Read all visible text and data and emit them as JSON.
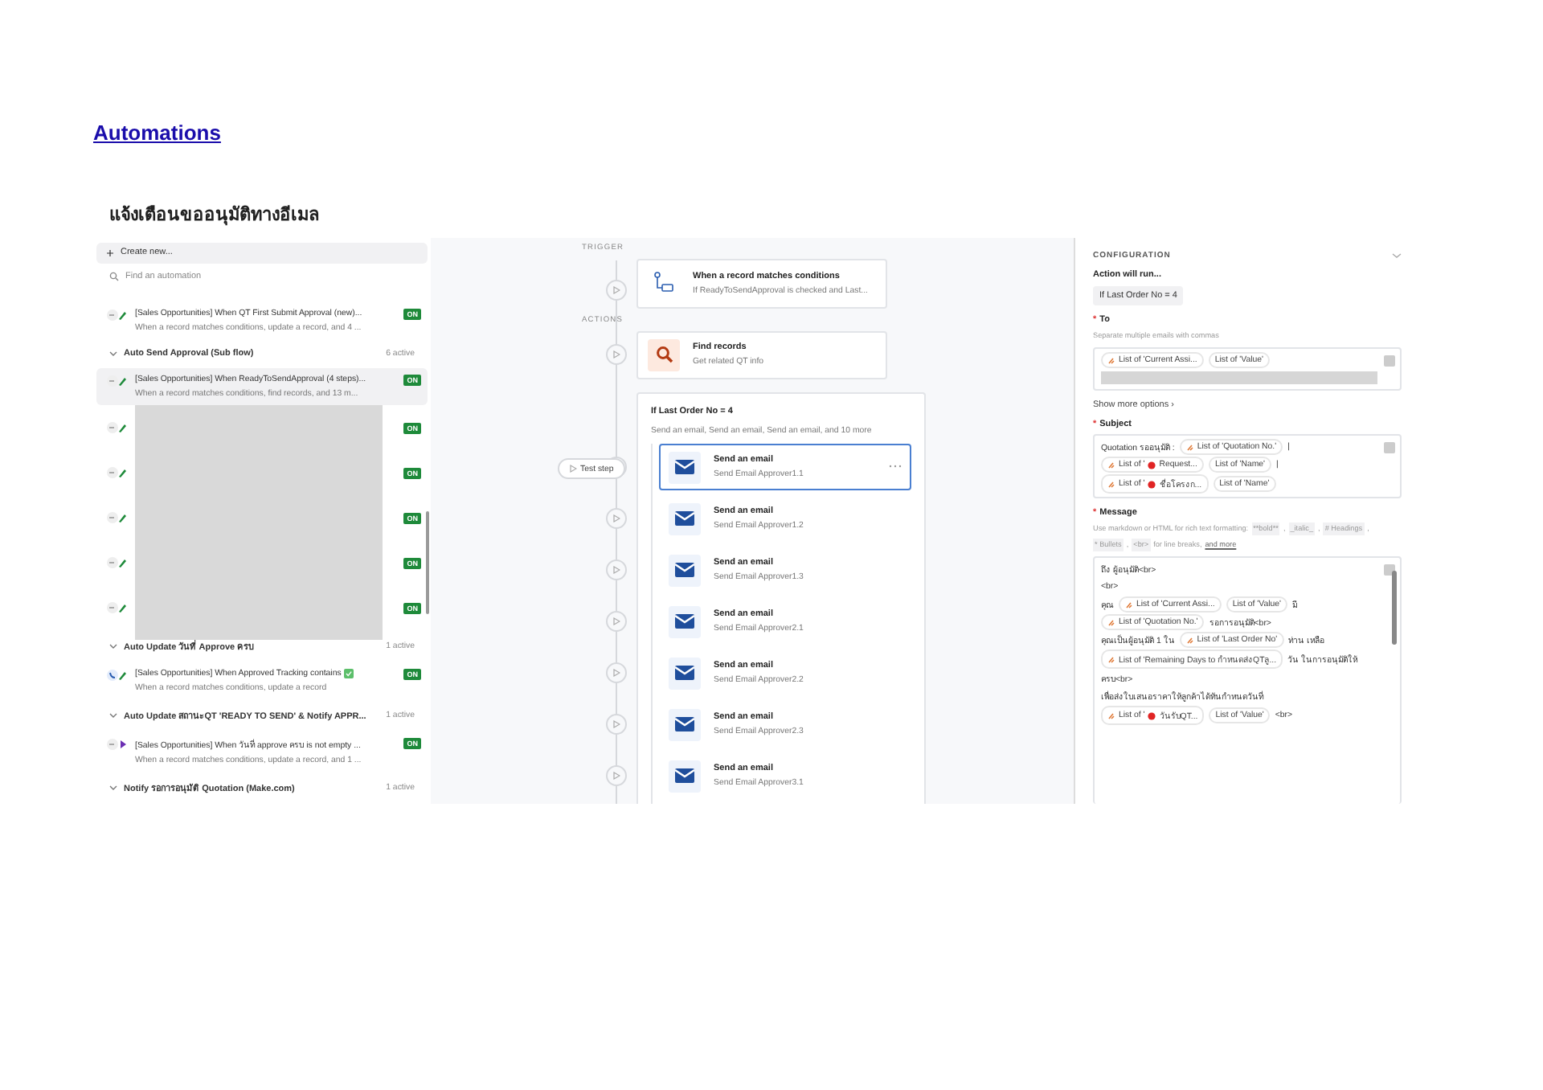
{
  "page": {
    "link": "Automations",
    "heading": "แจ้งเตือนขออนุมัติทางอีเมล"
  },
  "sidebar": {
    "create": "Create new...",
    "search_placeholder": "Find an automation",
    "items": [
      {
        "kind": "automation",
        "title": "[Sales Opportunities] When QT First Submit Approval (new)...",
        "subtitle": "When a record matches conditions, update a record, and 4 ...",
        "badge": "ON",
        "selected": false
      },
      {
        "kind": "group",
        "title": "Auto Send Approval (Sub flow)",
        "count": "6 active"
      },
      {
        "kind": "automation",
        "title": "[Sales Opportunities] When ReadyToSendApproval (4 steps)...",
        "subtitle": "When a record matches conditions, find records, and 13 m...",
        "badge": "ON",
        "selected": true
      },
      {
        "kind": "redacted",
        "rows": [
          {
            "badge": "ON"
          },
          {
            "badge": "ON"
          },
          {
            "badge": "ON"
          },
          {
            "badge": "ON"
          },
          {
            "badge": "ON"
          }
        ]
      },
      {
        "kind": "group",
        "title": "Auto Update วันที่ Approve ครบ",
        "count": "1 active"
      },
      {
        "kind": "automation",
        "title": "[Sales Opportunities] When Approved Tracking contains",
        "checkmark": true,
        "subtitle": "When a record matches conditions, update a record",
        "badge": "ON",
        "selected": false
      },
      {
        "kind": "group",
        "title": "Auto Update สถานะQT 'READY TO SEND' & Notify APPR...",
        "count": "1 active"
      },
      {
        "kind": "automation",
        "title": "[Sales Opportunities] When วันที่ approve ครบ is not empty ...",
        "subtitle": "When a record matches conditions, update a record, and 1 ...",
        "badge": "ON",
        "selected": false
      },
      {
        "kind": "group",
        "title": "Notify รอการอนุมัติ Quotation (Make.com)",
        "count": "1 active"
      }
    ]
  },
  "flow": {
    "trigger_label": "TRIGGER",
    "trigger": {
      "title": "When a record matches conditions",
      "subtitle": "If ReadyToSendApproval is checked and Last..."
    },
    "actions_label": "ACTIONS",
    "find": {
      "title": "Find records",
      "subtitle": "Get related QT info"
    },
    "condition": {
      "title": "If Last Order No = 4",
      "summary": "Send an email, Send an email, Send an email, and 10 more",
      "test_step": "Test step",
      "steps": [
        {
          "title": "Send an email",
          "subtitle": "Send Email Approver1.1",
          "selected": true
        },
        {
          "title": "Send an email",
          "subtitle": "Send Email Approver1.2",
          "selected": false
        },
        {
          "title": "Send an email",
          "subtitle": "Send Email Approver1.3",
          "selected": false
        },
        {
          "title": "Send an email",
          "subtitle": "Send Email Approver2.1",
          "selected": false
        },
        {
          "title": "Send an email",
          "subtitle": "Send Email Approver2.2",
          "selected": false
        },
        {
          "title": "Send an email",
          "subtitle": "Send Email Approver2.3",
          "selected": false
        },
        {
          "title": "Send an email",
          "subtitle": "Send Email Approver3.1",
          "selected": false
        }
      ]
    }
  },
  "config": {
    "heading": "CONFIGURATION",
    "run_label": "Action will run...",
    "run_chip": "If Last Order No = 4",
    "to": {
      "mark": "*",
      "label": "To",
      "hint": "Separate multiple emails with commas",
      "lines": [
        [
          {
            "kind": "token",
            "icon": true,
            "parts": [
              "List of 'Current Assi..."
            ]
          },
          {
            "kind": "token",
            "icon": false,
            "parts": [
              "List of 'Value'"
            ]
          }
        ],
        [
          {
            "kind": "redacted"
          }
        ]
      ]
    },
    "more": "Show more options ›",
    "subject": {
      "mark": "*",
      "label": "Subject",
      "lines": [
        [
          {
            "kind": "text",
            "text": "Quotation รออนุมัติ :"
          },
          {
            "kind": "token",
            "icon": true,
            "parts": [
              "List of 'Quotation No.'"
            ]
          },
          {
            "kind": "text",
            "text": "|"
          }
        ],
        [
          {
            "kind": "token",
            "icon": true,
            "dot": true,
            "parts": [
              "List of '",
              "Request..."
            ]
          },
          {
            "kind": "token",
            "icon": false,
            "parts": [
              "List of 'Name'"
            ]
          },
          {
            "kind": "text",
            "text": "|"
          }
        ],
        [
          {
            "kind": "token",
            "icon": true,
            "dot": true,
            "parts": [
              "List of '",
              "ชื่อโครงก..."
            ]
          },
          {
            "kind": "token",
            "icon": false,
            "parts": [
              "List of 'Name'"
            ]
          }
        ]
      ]
    },
    "message": {
      "mark": "*",
      "label": "Message",
      "hint": [
        {
          "kind": "text",
          "text": "Use markdown or HTML for rich text formatting:"
        },
        {
          "kind": "code",
          "text": "**bold**"
        },
        {
          "kind": "text",
          "text": ","
        },
        {
          "kind": "code",
          "text": "_italic_"
        },
        {
          "kind": "text",
          "text": ","
        },
        {
          "kind": "code",
          "text": "# Headings"
        },
        {
          "kind": "text",
          "text": ","
        },
        {
          "kind": "code",
          "text": "* Bullets"
        },
        {
          "kind": "text",
          "text": ","
        },
        {
          "kind": "code",
          "text": "<br>"
        },
        {
          "kind": "text",
          "text": "for line breaks,"
        },
        {
          "kind": "link",
          "text": "and more"
        }
      ],
      "lines": [
        [
          {
            "kind": "text",
            "text": "ถึง ผู้อนุมัติ<br>"
          }
        ],
        [
          {
            "kind": "text",
            "text": "<br>"
          }
        ],
        [
          {
            "kind": "text",
            "text": "คุณ"
          },
          {
            "kind": "token",
            "icon": true,
            "parts": [
              "List of 'Current Assi..."
            ]
          },
          {
            "kind": "token",
            "icon": false,
            "parts": [
              "List of 'Value'"
            ]
          },
          {
            "kind": "text",
            "text": "มี"
          }
        ],
        [
          {
            "kind": "token",
            "icon": true,
            "parts": [
              "List of 'Quotation No.'"
            ]
          },
          {
            "kind": "text",
            "text": "รอการอนุมัติ<br>"
          }
        ],
        [
          {
            "kind": "text",
            "text": "คุณเป็นผู้อนุมัติ 1 ใน"
          },
          {
            "kind": "token",
            "icon": true,
            "parts": [
              "List of 'Last Order No'"
            ]
          },
          {
            "kind": "text",
            "text": "ท่าน เหลือ"
          }
        ],
        [
          {
            "kind": "token",
            "icon": true,
            "parts": [
              "List of 'Remaining Days to กำหนดส่งQTลู..."
            ]
          },
          {
            "kind": "text",
            "text": "วัน ในการอนุมัติให้"
          }
        ],
        [
          {
            "kind": "text",
            "text": "ครบ<br>"
          }
        ],
        [
          {
            "kind": "text",
            "text": "เพื่อส่งใบเสนอราคาให้ลูกค้าได้ทันกำหนดวันที่"
          }
        ],
        [
          {
            "kind": "token",
            "icon": true,
            "dot": true,
            "parts": [
              "List of '",
              "วันรับQT..."
            ]
          },
          {
            "kind": "token",
            "icon": false,
            "parts": [
              "List of 'Value'"
            ]
          },
          {
            "kind": "text",
            "text": "<br>"
          }
        ]
      ]
    }
  }
}
